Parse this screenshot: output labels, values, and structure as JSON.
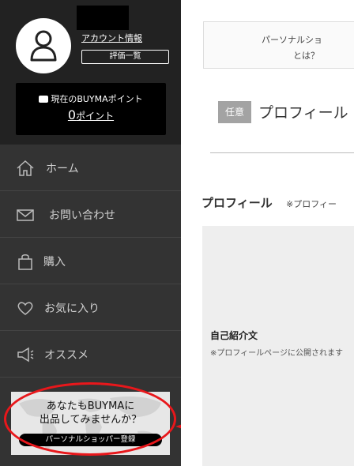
{
  "sidebar": {
    "account_link": "アカウント情報",
    "review_button": "評価一覧",
    "points_label": "現在のBUYMAポイント",
    "points_value": "0",
    "points_unit": "ポイント",
    "nav": [
      {
        "label": "ホーム",
        "icon": "home-icon"
      },
      {
        "label": "お問い合わせ",
        "icon": "mail-icon"
      },
      {
        "label": "購入",
        "icon": "shopping-bag-icon"
      },
      {
        "label": "お気に入り",
        "icon": "heart-icon"
      },
      {
        "label": "オススメ",
        "icon": "megaphone-icon"
      }
    ],
    "banner": {
      "line1": "あなたもBUYMAに",
      "line2": "出品してみませんか？",
      "button": "パーソナルショッパー登録"
    }
  },
  "main": {
    "info_line1": "パーソナルショ",
    "info_line2": "とは？",
    "optional_badge": "任意",
    "section_heading": "プロフィール",
    "profile_title": "プロフィール",
    "profile_note": "※プロフィー",
    "intro_label": "自己紹介文",
    "intro_note": "※プロフィールページに公開されます"
  },
  "colors": {
    "sidebar_bg": "#333333",
    "profile_bg": "#222222",
    "highlight_red": "#e8171b",
    "badge_gray": "#a3a3a3"
  }
}
